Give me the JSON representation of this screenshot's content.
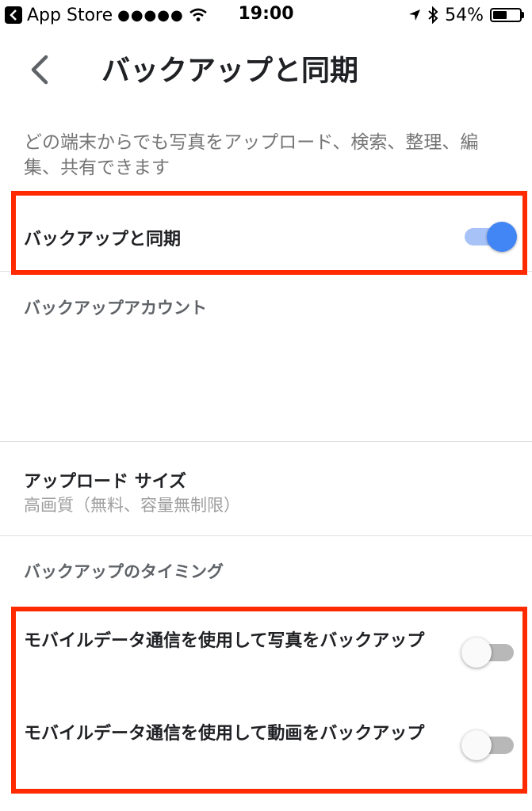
{
  "status_bar": {
    "back_app": "App Store",
    "signal_dots": "●●●●●",
    "time": "19:00",
    "battery": "54%",
    "battery_level": 0.54
  },
  "header": {
    "title": "バックアップと同期"
  },
  "description": "どの端末からでも写真をアップロード、検索、整理、編集、共有できます",
  "backup_sync": {
    "label": "バックアップと同期",
    "enabled": true
  },
  "backup_account": {
    "label": "バックアップアカウント"
  },
  "upload_size": {
    "label": "アップロード サイズ",
    "value": "高画質（無料、容量無制限）"
  },
  "timing": {
    "label": "バックアップのタイミング",
    "photos_mobile": {
      "label": "モバイルデータ通信を使用して写真をバックアップ",
      "enabled": false
    },
    "videos_mobile": {
      "label": "モバイルデータ通信を使用して動画をバックアップ",
      "enabled": false
    }
  },
  "colors": {
    "accent": "#4285f4",
    "highlight": "#ff2a00"
  }
}
